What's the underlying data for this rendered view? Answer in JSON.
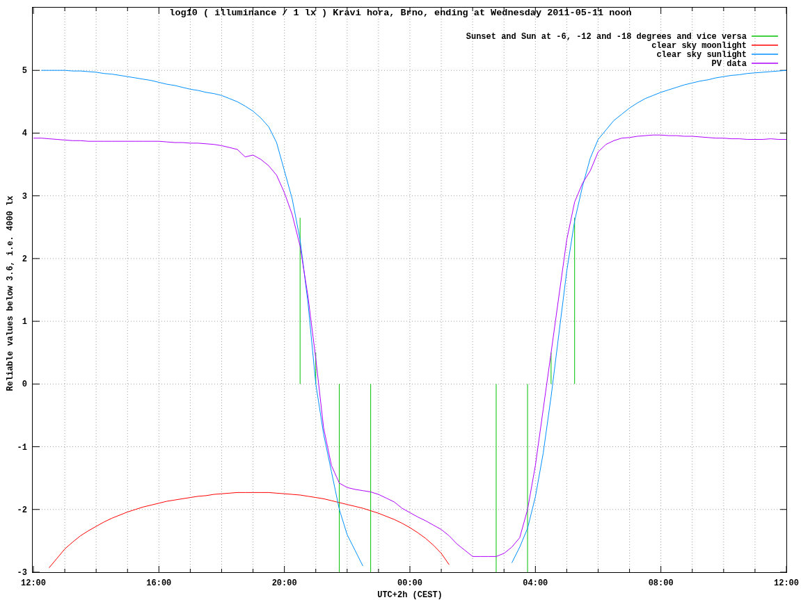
{
  "chart_data": {
    "type": "line",
    "title": "log10 ( illuminance / 1 lx ) Kravi hora, Brno, ending at Wednesday 2011-05-11 noon",
    "xlabel": "UTC+2h (CEST)",
    "ylabel": "Reliable values below 3.6, i.e. 4000 lx",
    "ylim": [
      -3,
      6
    ],
    "yticks": [
      -3,
      -2,
      -1,
      0,
      1,
      2,
      3,
      4,
      5
    ],
    "grid": true,
    "legend": true,
    "categories": [
      "12:00",
      null,
      null,
      null,
      null,
      null,
      null,
      null,
      null,
      null,
      null,
      null,
      null,
      null,
      null,
      null,
      "16:00",
      null,
      null,
      null,
      null,
      null,
      null,
      null,
      null,
      null,
      null,
      null,
      null,
      null,
      null,
      null,
      "20:00",
      null,
      null,
      null,
      null,
      null,
      null,
      null,
      null,
      null,
      null,
      null,
      null,
      null,
      null,
      null,
      "00:00",
      null,
      null,
      null,
      null,
      null,
      null,
      null,
      null,
      null,
      null,
      null,
      null,
      null,
      null,
      null,
      "04:00",
      null,
      null,
      null,
      null,
      null,
      null,
      null,
      null,
      null,
      null,
      null,
      null,
      null,
      null,
      null,
      "08:00",
      null,
      null,
      null,
      null,
      null,
      null,
      null,
      null,
      null,
      null,
      null,
      null,
      null,
      null,
      null,
      "12:00"
    ],
    "series": [
      {
        "name": "Sunset and Sun at -6, -12 and -18 degrees and vice versa",
        "color": "#00c000",
        "values": [
          null,
          null,
          null,
          null,
          null,
          null,
          null,
          null,
          null,
          null,
          null,
          null,
          null,
          null,
          null,
          null,
          null,
          null,
          null,
          null,
          null,
          null,
          null,
          null,
          null,
          null,
          null,
          null,
          null,
          null,
          null,
          null,
          null,
          null,
          null,
          null,
          null,
          null,
          null,
          null,
          null,
          null,
          null,
          null,
          null,
          null,
          null,
          null,
          null,
          null,
          null,
          null,
          null,
          null,
          null,
          null,
          null,
          null,
          null,
          null,
          null,
          null,
          null,
          null,
          null,
          null,
          null,
          null,
          null,
          null,
          null,
          null,
          null,
          null,
          null,
          null,
          null,
          null,
          null,
          null,
          null,
          null,
          null,
          null,
          null,
          null,
          null,
          null,
          null,
          null,
          null,
          null,
          null,
          null,
          null,
          null,
          null
        ]
      },
      {
        "name": "clear sky moonlight",
        "color": "#ff0000",
        "values": [
          null,
          null,
          -2.93,
          -2.78,
          -2.63,
          -2.52,
          -2.42,
          -2.34,
          -2.27,
          -2.2,
          -2.14,
          -2.09,
          -2.04,
          -2.0,
          -1.96,
          -1.93,
          -1.9,
          -1.87,
          -1.85,
          -1.83,
          -1.81,
          -1.79,
          -1.78,
          -1.76,
          -1.75,
          -1.74,
          -1.73,
          -1.73,
          -1.73,
          -1.73,
          -1.73,
          -1.74,
          -1.75,
          -1.76,
          -1.77,
          -1.79,
          -1.81,
          -1.83,
          -1.86,
          -1.89,
          -1.92,
          -1.95,
          -1.98,
          -2.02,
          -2.06,
          -2.11,
          -2.16,
          -2.22,
          -2.29,
          -2.37,
          -2.46,
          -2.57,
          -2.7,
          -2.88,
          null,
          null,
          null,
          null,
          null,
          null,
          null,
          null,
          null,
          null,
          null,
          null,
          null,
          null,
          null,
          null,
          null,
          null,
          null,
          null,
          null,
          null,
          null,
          null,
          null,
          null,
          null,
          null,
          null,
          null,
          null,
          null,
          null,
          null,
          null,
          null,
          null,
          null,
          null,
          null,
          null,
          null,
          null
        ]
      },
      {
        "name": "clear sky sunlight",
        "color": "#0090ff",
        "values": [
          null,
          5,
          5,
          5,
          5,
          4.99,
          4.99,
          4.98,
          4.97,
          4.95,
          4.94,
          4.92,
          4.9,
          4.88,
          4.86,
          4.84,
          4.81,
          4.78,
          4.76,
          4.73,
          4.7,
          4.68,
          4.65,
          4.63,
          4.6,
          4.55,
          4.5,
          4.43,
          4.35,
          4.24,
          4.1,
          3.85,
          3.4,
          2.95,
          2.3,
          1.3,
          0,
          -0.8,
          -1.4,
          -2.0,
          -2.4,
          -2.65,
          -2.9,
          null,
          null,
          null,
          null,
          null,
          null,
          null,
          null,
          null,
          null,
          null,
          null,
          null,
          null,
          null,
          null,
          null,
          null,
          -2.85,
          -2.6,
          -2.3,
          -1.8,
          -1.1,
          -0.2,
          0.8,
          1.8,
          2.6,
          3.15,
          3.6,
          3.9,
          4.05,
          4.2,
          4.3,
          4.4,
          4.48,
          4.55,
          4.6,
          4.65,
          4.69,
          4.73,
          4.77,
          4.8,
          4.83,
          4.85,
          4.88,
          4.9,
          4.92,
          4.93,
          4.95,
          4.96,
          4.97,
          4.98,
          4.99,
          5
        ]
      },
      {
        "name": "PV data",
        "color": "#b000ff",
        "values": [
          3.92,
          3.92,
          3.91,
          3.9,
          3.89,
          3.88,
          3.88,
          3.87,
          3.87,
          3.87,
          3.87,
          3.87,
          3.87,
          3.87,
          3.87,
          3.87,
          3.87,
          3.86,
          3.85,
          3.85,
          3.84,
          3.84,
          3.83,
          3.82,
          3.8,
          3.77,
          3.74,
          3.62,
          3.65,
          3.58,
          3.48,
          3.33,
          3.05,
          2.7,
          2.2,
          1.4,
          0.4,
          -0.7,
          -1.3,
          -1.58,
          -1.65,
          -1.68,
          -1.7,
          -1.72,
          -1.76,
          -1.82,
          -1.88,
          -1.98,
          -2.05,
          -2.12,
          -2.18,
          -2.25,
          -2.32,
          -2.42,
          -2.55,
          -2.65,
          -2.75,
          -2.75,
          -2.75,
          -2.75,
          -2.7,
          -2.6,
          -2.45,
          -2.0,
          -1.3,
          -0.4,
          0.5,
          1.4,
          2.3,
          2.9,
          3.2,
          3.4,
          3.7,
          3.82,
          3.88,
          3.92,
          3.93,
          3.95,
          3.96,
          3.97,
          3.97,
          3.96,
          3.96,
          3.95,
          3.95,
          3.94,
          3.93,
          3.92,
          3.92,
          3.91,
          3.91,
          3.9,
          3.9,
          3.9,
          3.91,
          3.9,
          3.9
        ]
      }
    ]
  }
}
